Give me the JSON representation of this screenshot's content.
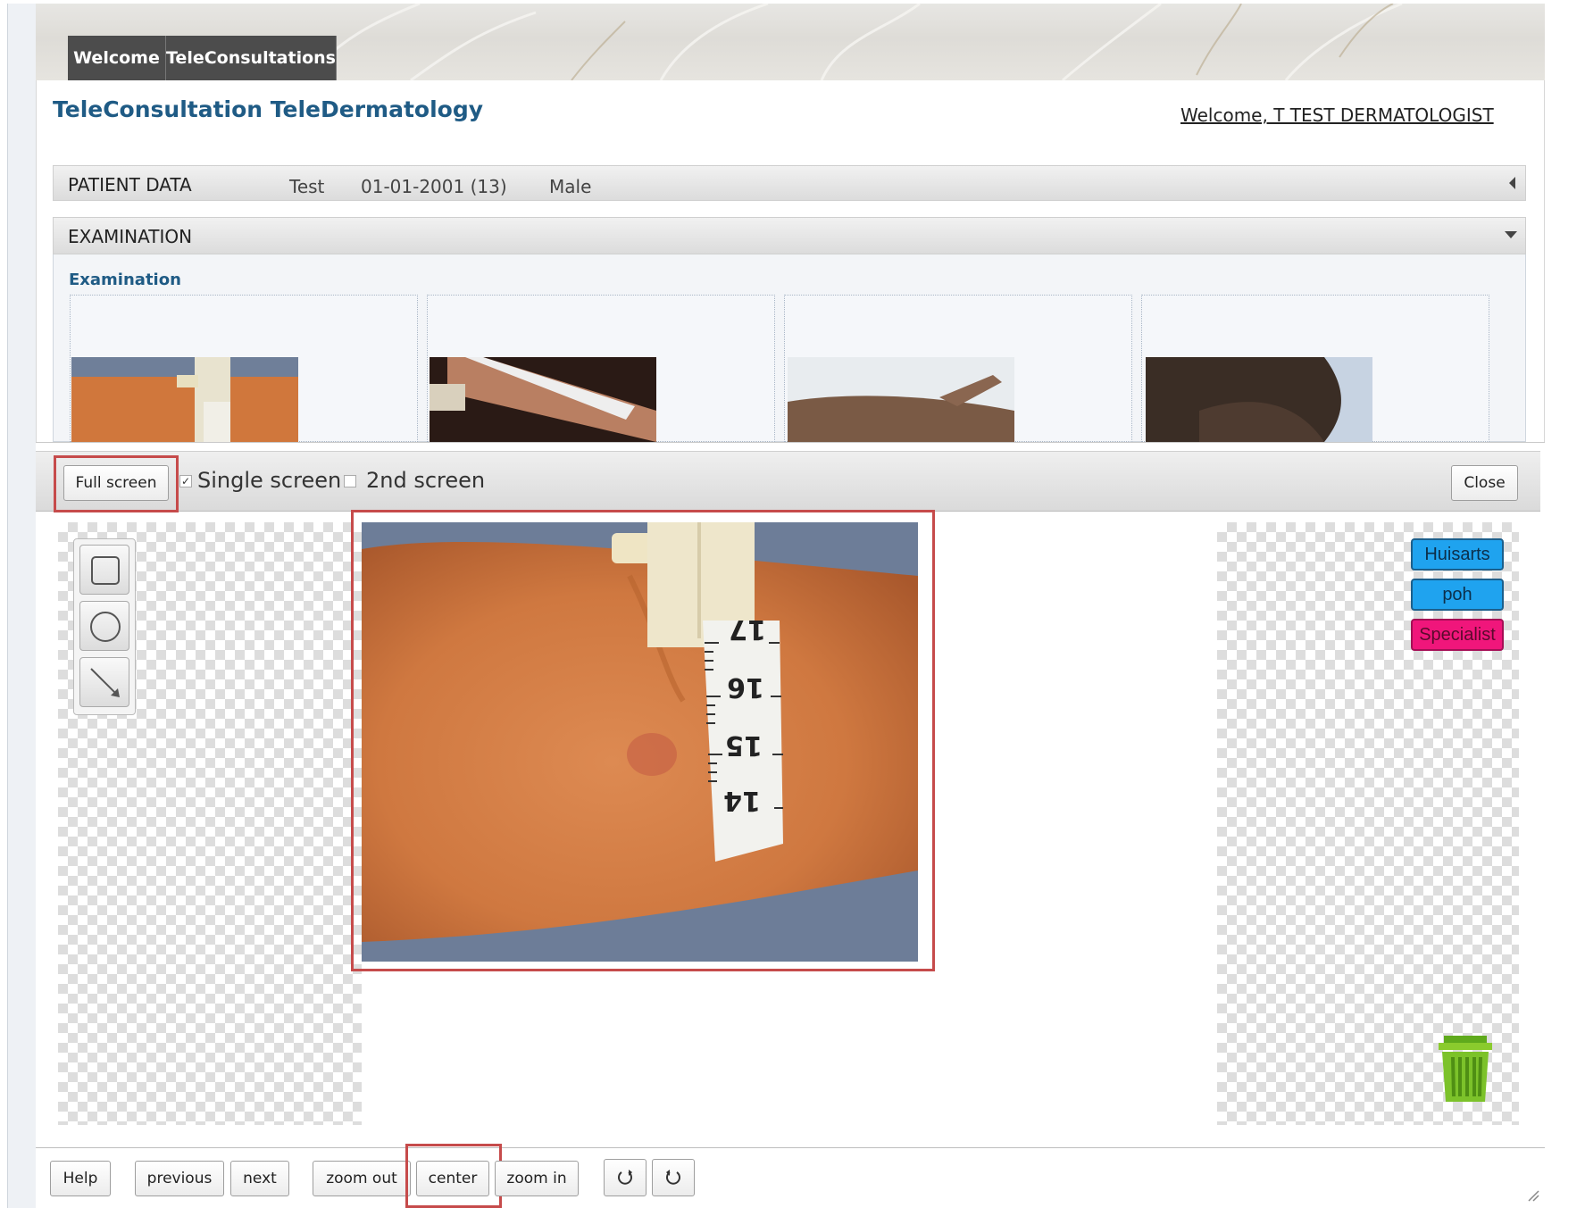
{
  "nav": {
    "tabs": [
      "Welcome",
      "TeleConsultations"
    ]
  },
  "header": {
    "title": "TeleConsultation TeleDermatology",
    "welcome": "Welcome, T TEST DERMATOLOGIST"
  },
  "patient": {
    "section_label": "PATIENT DATA",
    "name": "Test",
    "dob_age": "01-01-2001 (13)",
    "sex": "Male"
  },
  "examination": {
    "section_label": "EXAMINATION",
    "heading": "Examination"
  },
  "viewer": {
    "full_screen": "Full screen",
    "single_screen": "Single screen",
    "single_screen_checked": true,
    "second_screen": "2nd screen",
    "second_screen_checked": false,
    "close": "Close",
    "tags": [
      {
        "label": "Huisarts",
        "color": "#1fa3ef"
      },
      {
        "label": "poh",
        "color": "#1fa3ef"
      },
      {
        "label": "Specialist",
        "color": "#f0167b"
      }
    ],
    "tape_numbers": [
      "17",
      "16",
      "15",
      "14"
    ]
  },
  "controls": {
    "help": "Help",
    "previous": "previous",
    "next": "next",
    "zoom_out": "zoom out",
    "center": "center",
    "zoom_in": "zoom in"
  },
  "colors": {
    "accent": "#1f5b85",
    "highlight": "#c64b4b",
    "tab_bg": "#4c4c4c"
  }
}
